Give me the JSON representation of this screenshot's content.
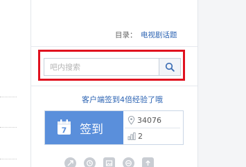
{
  "catalog": {
    "label": "目录：",
    "link_text": "电视剧话题"
  },
  "search": {
    "placeholder": "吧内搜索",
    "value": "",
    "icon": "search-icon"
  },
  "promo_text": "客户端签到4倍经验了哦",
  "sign_in": {
    "label": "签到",
    "calendar_day": "7",
    "icon": "calendar-icon",
    "members_count": "34076",
    "members_icon": "location-pin-icon",
    "rank": "2",
    "rank_icon": "bar-chart-icon"
  },
  "tools": [
    {
      "icon": "share-icon"
    },
    {
      "icon": "clock-icon"
    },
    {
      "icon": "image-icon"
    },
    {
      "icon": "no-entry-icon"
    },
    {
      "icon": "upload-icon"
    }
  ],
  "colors": {
    "accent_blue": "#5a8fdb",
    "link_blue": "#2d64b3",
    "highlight_red": "#e0111f"
  }
}
